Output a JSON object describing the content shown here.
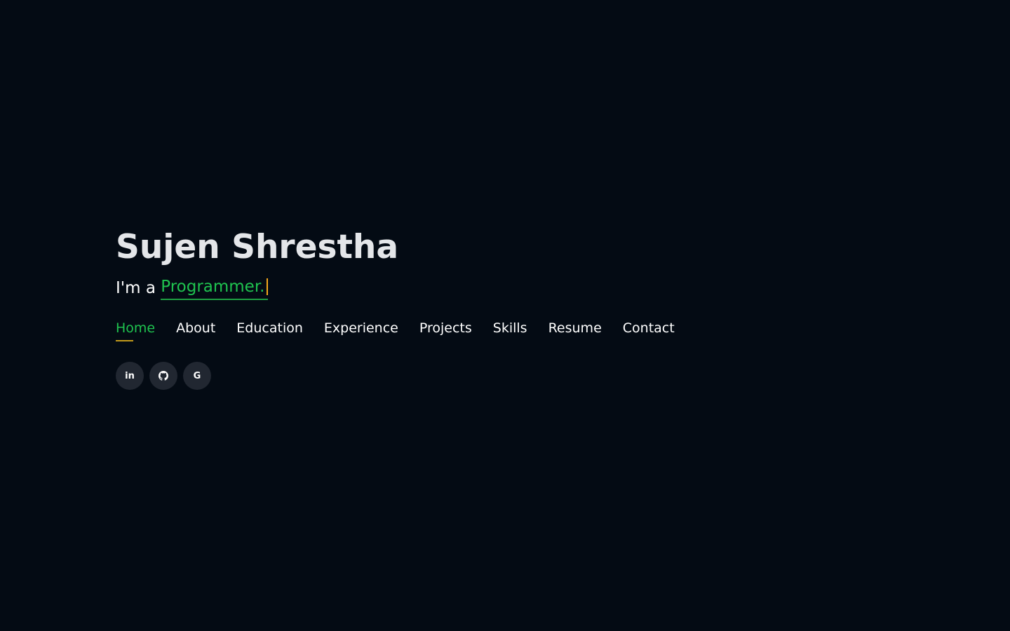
{
  "hero": {
    "name": "Sujen Shrestha",
    "tagline_prefix": "I'm a ",
    "typed_role": "Programmer."
  },
  "nav": {
    "items": [
      {
        "label": "Home",
        "active": true
      },
      {
        "label": "About",
        "active": false
      },
      {
        "label": "Education",
        "active": false
      },
      {
        "label": "Experience",
        "active": false
      },
      {
        "label": "Projects",
        "active": false
      },
      {
        "label": "Skills",
        "active": false
      },
      {
        "label": "Resume",
        "active": false
      },
      {
        "label": "Contact",
        "active": false
      }
    ]
  },
  "social": {
    "linkedin_glyph": "in",
    "google_glyph": "G",
    "icons": [
      "linkedin-icon",
      "github-icon",
      "google-icon"
    ]
  },
  "colors": {
    "background": "#040b14",
    "accent_green": "#1fc34f",
    "underline_gold": "#c39a1b",
    "cursor": "#f6a91b",
    "icon_bg": "#212731",
    "name_text": "#e4e6e9"
  }
}
